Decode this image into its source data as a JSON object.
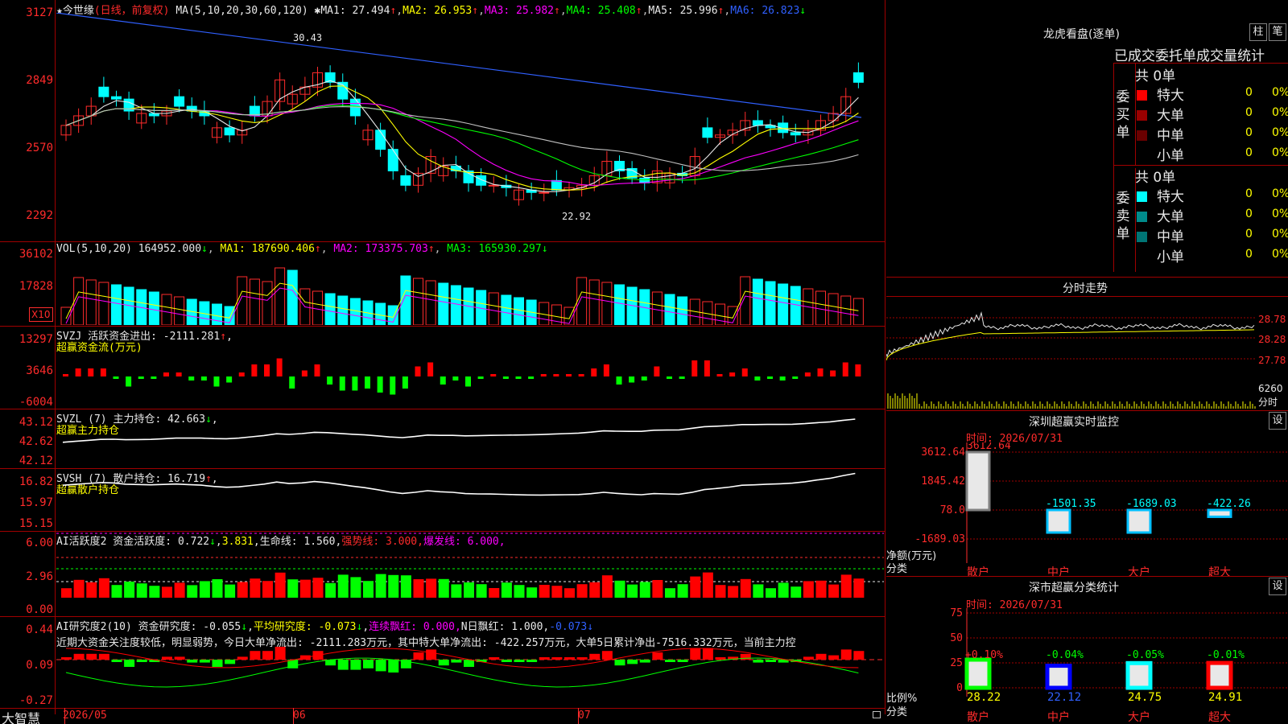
{
  "stock": {
    "star": "★",
    "name": "今世缘",
    "mode": "(日线，前复权)",
    "ma_params": "MA(5,10,20,30,60,120)",
    "ma_vals": [
      {
        "label": "MA1:",
        "value": "27.494",
        "arrow": "↑"
      },
      {
        "label": "MA2:",
        "value": "26.953",
        "arrow": "↑"
      },
      {
        "label": "MA3:",
        "value": "25.982",
        "arrow": "↑"
      },
      {
        "label": "MA4:",
        "value": "25.408",
        "arrow": "↑"
      },
      {
        "label": "MA5:",
        "value": "25.996",
        "arrow": "↑"
      },
      {
        "label": "MA6:",
        "value": "26.823",
        "arrow": "↓"
      }
    ],
    "max_note": "30.43",
    "min_note": "22.92",
    "mark": "✱"
  },
  "price_axis": [
    "3127",
    "2849",
    "2570",
    "2292"
  ],
  "vol": {
    "params": "VOL(5,10,20)",
    "value": "164952.000",
    "arrow1": "↓",
    "ma1": "MA1: 187690.406",
    "a2": "↑",
    "ma2": "MA2: 173375.703",
    "a3": "↑",
    "ma3": "MA3: 165930.297",
    "a4": "↓",
    "axis": [
      "36102",
      "17828"
    ],
    "unit": "X10"
  },
  "svzj": {
    "title": "SVZJ  活跃资金进出: -2111.281",
    "arrow": "↑",
    "comma": ",",
    "subtitle": "超赢资金流(万元)",
    "axis": [
      "13297",
      "3646",
      "-6004"
    ]
  },
  "svzl": {
    "title": "SVZL (7) 主力持仓: 42.663",
    "arrow": "↓",
    "comma": ",",
    "subtitle": "超赢主力持仓",
    "axis": [
      "43.12",
      "42.62",
      "42.12"
    ]
  },
  "svsh": {
    "title": "SVSH (7) 散户持仓: 16.719",
    "arrow": "↑",
    "comma": ",",
    "subtitle": "超赢散户持仓",
    "axis": [
      "16.82",
      "15.97",
      "15.15"
    ]
  },
  "ai1": {
    "title": "AI活跃度2 资金活跃度: 0.722",
    "a1": "↓",
    "v2": "3.831",
    "comma": ",",
    "life": "生命线: 1.560,",
    "strong": "强势线: 3.000,",
    "burst": "爆发线: 6.000,",
    "axis": [
      "6.00",
      "2.96",
      "0.00"
    ]
  },
  "ai2": {
    "title": "AI研究度2(10) 资金研究度: -0.055",
    "a1": "↓",
    "comma": ",",
    "avg": "平均研究度: -0.073",
    "a2": "↓",
    "comma2": ",",
    "lianxu": "连续飘红: 0.000,",
    "nday": "N日飘红: 1.000,",
    "last": "-0.073",
    "a3": "↓",
    "text": "近期大资金关注度较低，明显弱势，今日大单净流出: -2111.283万元，其中特大单净流出: -422.257万元，大单5日累计净出-7516.332万元，当前主力控",
    "axis": [
      "0.44",
      "0.09",
      "-0.27"
    ]
  },
  "bottom": {
    "brand": "大智慧",
    "dates": [
      "2026/05",
      "06",
      "07"
    ]
  },
  "longhu": {
    "title": "龙虎看盘(逐单)",
    "btn1": "柱",
    "btn2": "笔",
    "subtitle": "已成交委托单成交量统计",
    "buy_label": "委买单",
    "sell_label": "委卖单",
    "buy_total": "共 0单",
    "sell_total": "共 0单",
    "buy_rows": [
      {
        "label": "特大",
        "count": "0",
        "pct": "0%",
        "color": "#ff0000"
      },
      {
        "label": "大单",
        "count": "0",
        "pct": "0%",
        "color": "#9a0000"
      },
      {
        "label": "中单",
        "count": "0",
        "pct": "0%",
        "color": "#6a0000"
      },
      {
        "label": "小单",
        "count": "0",
        "pct": "0%",
        "color": "#000000"
      }
    ],
    "sell_rows": [
      {
        "label": "特大",
        "count": "0",
        "pct": "0%",
        "color": "#00ffff"
      },
      {
        "label": "大单",
        "count": "0",
        "pct": "0%",
        "color": "#008b8b"
      },
      {
        "label": "中单",
        "count": "0",
        "pct": "0%",
        "color": "#007575"
      },
      {
        "label": "小单",
        "count": "0",
        "pct": "0%",
        "color": "#000000"
      }
    ]
  },
  "fenshi": {
    "title": "分时走势",
    "axis": [
      "28.78",
      "28.28",
      "27.78"
    ],
    "vol": "6260",
    "label": "分时"
  },
  "monitor": {
    "title": "深圳超赢实时监控",
    "btn": "设",
    "time": "时间: 2026/07/31",
    "axis": [
      "3612.64",
      "1845.42",
      "78.0",
      "-1689.03"
    ],
    "ylabel": "净额(万元)",
    "xlabel": "分类",
    "bars": [
      {
        "name": "散户",
        "value": "3612.64"
      },
      {
        "name": "中户",
        "value": "-1501.35"
      },
      {
        "name": "大户",
        "value": "-1689.03"
      },
      {
        "name": "超大",
        "value": "-422.26"
      }
    ]
  },
  "classify": {
    "title": "深市超赢分类统计",
    "btn": "设",
    "time": "时间: 2026/07/31",
    "axis": [
      "75",
      "50",
      "25",
      "0"
    ],
    "ylabel": "比例%",
    "xlabel": "分类",
    "bars": [
      {
        "name": "散户",
        "top": "+0.10%",
        "bottom": "28.22"
      },
      {
        "name": "中户",
        "top": "-0.04%",
        "bottom": "22.12"
      },
      {
        "name": "大户",
        "top": "-0.05%",
        "bottom": "24.75"
      },
      {
        "name": "超大",
        "top": "-0.01%",
        "bottom": "24.91"
      }
    ]
  },
  "colors": {
    "up": "#ff2b2b",
    "down": "#00ffff",
    "ma1": "#e8e8e8",
    "ma2": "#ffff00",
    "ma3": "#ff00ff",
    "ma4": "#00ff00",
    "ma6": "#3060ff"
  },
  "chart_data": {
    "type": "candlestick",
    "series_close": [
      2660,
      2700,
      2740,
      2780,
      2770,
      2720,
      2710,
      2700,
      2720,
      2740,
      2720,
      2700,
      2650,
      2620,
      2640,
      2700,
      2760,
      2850,
      2790,
      2820,
      2880,
      2840,
      2770,
      2700,
      2640,
      2560,
      2470,
      2410,
      2460,
      2530,
      2490,
      2470,
      2420,
      2410,
      2410,
      2400,
      2390,
      2380,
      2380,
      2390,
      2400,
      2410,
      2450,
      2510,
      2470,
      2440,
      2420,
      2470,
      2460,
      2450,
      2530,
      2610,
      2620,
      2640,
      2680,
      2660,
      2650,
      2630,
      2620,
      2640,
      2680,
      2710,
      2780,
      2840
    ]
  }
}
